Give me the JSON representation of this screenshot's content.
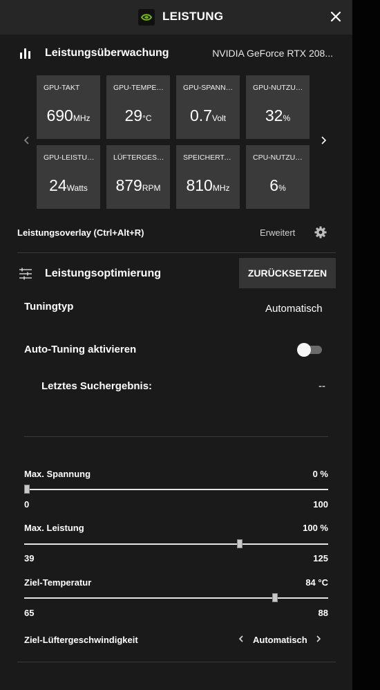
{
  "window": {
    "title": "LEISTUNG",
    "accent_color": "#76b900"
  },
  "monitoring": {
    "title": "Leistungsüberwachung",
    "gpu_name": "NVIDIA GeForce RTX 208...",
    "prev_icon": "chevron-left-icon",
    "next_icon": "chevron-right-icon",
    "tiles": [
      {
        "label": "GPU-TAKT",
        "value": "690",
        "unit": "MHz"
      },
      {
        "label": "GPU-TEMPERATUR",
        "value": "29",
        "unit": "°C"
      },
      {
        "label": "GPU-SPANNUNG",
        "value": "0.7",
        "unit": "Volt"
      },
      {
        "label": "GPU-NUTZUNG",
        "value": "32",
        "unit": "%"
      },
      {
        "label": "GPU-LEISTUNG",
        "value": "24",
        "unit": "Watts"
      },
      {
        "label": "LÜFTERGESCHWINDIGKEIT",
        "value": "879",
        "unit": "RPM"
      },
      {
        "label": "SPEICHERTAKT",
        "value": "810",
        "unit": "MHz"
      },
      {
        "label": "CPU-NUTZUNG",
        "value": "6",
        "unit": "%"
      }
    ]
  },
  "overlay": {
    "label": "Leistungsoverlay (Ctrl+Alt+R)",
    "advanced": "Erweitert"
  },
  "tuning": {
    "title": "Leistungsoptimierung",
    "reset_label": "ZURÜCKSETZEN",
    "type_label": "Tuningtyp",
    "type_value": "Automatisch",
    "auto_label": "Auto-Tuning aktivieren",
    "auto_enabled": false,
    "last_result_label": "Letztes Suchergebnis:",
    "last_result_value": "--"
  },
  "sliders": [
    {
      "label": "Max. Spannung",
      "value_text": "0 %",
      "min": "0",
      "max": "100",
      "position": 0.01
    },
    {
      "label": "Max. Leistung",
      "value_text": "100 %",
      "min": "39",
      "max": "125",
      "position": 0.71
    },
    {
      "label": "Ziel-Temperatur",
      "value_text": "84 °C",
      "min": "65",
      "max": "88",
      "position": 0.826
    }
  ],
  "fan_target": {
    "label": "Ziel-Lüftergeschwindigkeit",
    "value": "Automatisch"
  }
}
